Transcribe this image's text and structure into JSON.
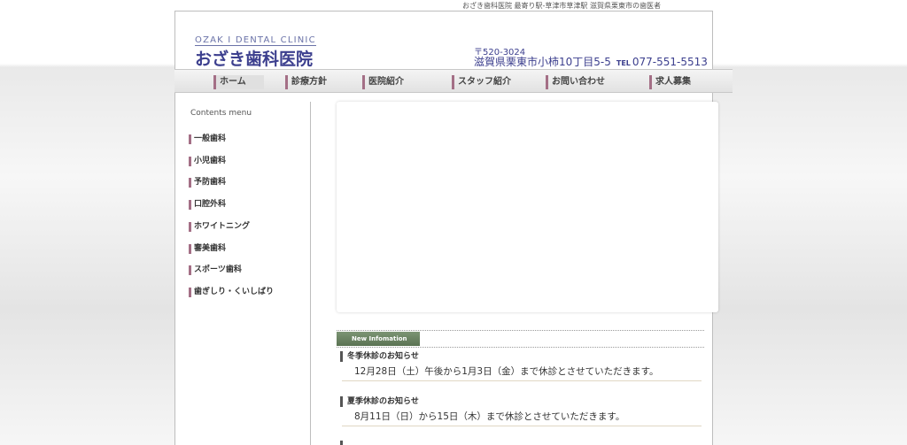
{
  "header": {
    "topline": "おざき歯科医院 最寄り駅-草津市草津駅 滋賀県栗東市の歯医者",
    "logo_en": "OZAK I DENTAL CLINIC",
    "logo_ja": "おざき歯科医院",
    "zip": "〒520-3024",
    "address": "滋賀県栗東市小柿10丁目5-5",
    "tel_label": "TEL",
    "tel": "077-551-5513"
  },
  "nav": {
    "items": [
      {
        "label": "ホーム"
      },
      {
        "label": "診療方針"
      },
      {
        "label": "医院紹介"
      },
      {
        "label": "スタッフ紹介"
      },
      {
        "label": "お問い合わせ"
      },
      {
        "label": "求人募集"
      }
    ]
  },
  "sidebar": {
    "title": "Contents menu",
    "items": [
      {
        "label": "一般歯科"
      },
      {
        "label": "小児歯科"
      },
      {
        "label": "予防歯科"
      },
      {
        "label": "口腔外科"
      },
      {
        "label": "ホワイトニング"
      },
      {
        "label": "審美歯科"
      },
      {
        "label": "スポーツ歯科"
      },
      {
        "label": "歯ぎしり・くいしばり"
      }
    ]
  },
  "news": {
    "header": "New Infomation",
    "items": [
      {
        "title": "冬季休診のお知らせ",
        "body": "12月28日（土）午後から1月3日（金）まで休診とさせていただきます。"
      },
      {
        "title": "夏季休診のお知らせ",
        "body": "8月11日（日）から15日（木）まで休診とさせていただきます。"
      }
    ]
  }
}
